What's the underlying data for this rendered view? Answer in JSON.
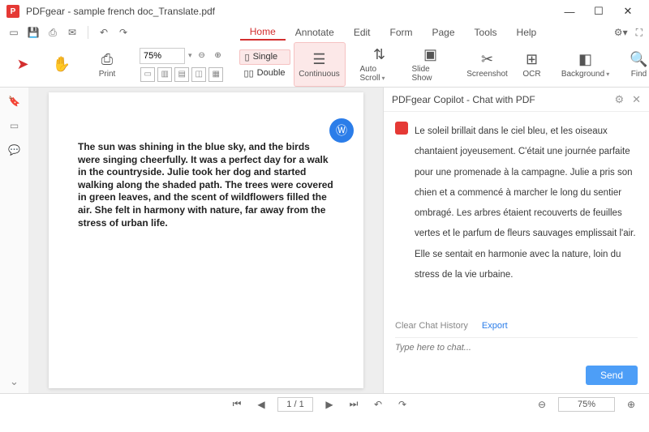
{
  "window": {
    "app_name": "PDFgear",
    "document_name": "sample french doc_Translate.pdf",
    "title": "PDFgear - sample french doc_Translate.pdf"
  },
  "menu": {
    "tabs": [
      "Home",
      "Annotate",
      "Edit",
      "Form",
      "Page",
      "Tools",
      "Help"
    ],
    "active": "Home"
  },
  "ribbon": {
    "print": "Print",
    "zoom_value": "75%",
    "single": "Single",
    "double": "Double",
    "continuous": "Continuous",
    "auto_scroll": "Auto Scroll",
    "slide_show": "Slide Show",
    "screenshot": "Screenshot",
    "ocr": "OCR",
    "background": "Background",
    "find": "Find"
  },
  "document": {
    "text": "The sun was shining in the blue sky, and the birds were singing cheerfully. It was a perfect day for a walk in the countryside. Julie took her dog and started walking along the shaded path. The trees were covered in green leaves, and the scent of wildflowers filled the air. She felt in harmony with nature, far away from the stress of urban life."
  },
  "copilot": {
    "title": "PDFgear Copilot - Chat with PDF",
    "message": "Le soleil brillait dans le ciel bleu, et les oiseaux chantaient joyeusement. C'était une journée parfaite pour une promenade à la campagne. Julie a pris son chien et a commencé à marcher le long du sentier ombragé. Les arbres étaient recouverts de feuilles vertes et le parfum de fleurs sauvages emplissait l'air. Elle se sentait en harmonie avec la nature, loin du stress de la vie urbaine.",
    "clear_history": "Clear Chat History",
    "export": "Export",
    "placeholder": "Type here to chat...",
    "send": "Send"
  },
  "status": {
    "page": "1 / 1",
    "zoom": "75%"
  }
}
